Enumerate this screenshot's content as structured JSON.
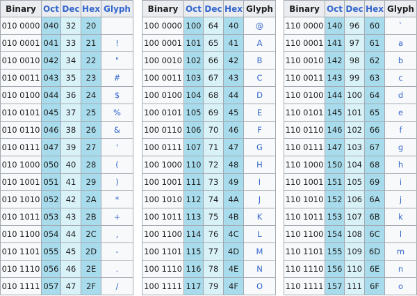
{
  "headers": {
    "binary": "Binary",
    "oct": "Oct",
    "dec": "Dec",
    "hex": "Hex",
    "glyph": "Glyph"
  },
  "tables": [
    {
      "rows": [
        [
          "010 0000",
          "040",
          "32",
          "20",
          ""
        ],
        [
          "010 0001",
          "041",
          "33",
          "21",
          "!"
        ],
        [
          "010 0010",
          "042",
          "34",
          "22",
          "\""
        ],
        [
          "010 0011",
          "043",
          "35",
          "23",
          "#"
        ],
        [
          "010 0100",
          "044",
          "36",
          "24",
          "$"
        ],
        [
          "010 0101",
          "045",
          "37",
          "25",
          "%"
        ],
        [
          "010 0110",
          "046",
          "38",
          "26",
          "&"
        ],
        [
          "010 0111",
          "047",
          "39",
          "27",
          "'"
        ],
        [
          "010 1000",
          "050",
          "40",
          "28",
          "("
        ],
        [
          "010 1001",
          "051",
          "41",
          "29",
          ")"
        ],
        [
          "010 1010",
          "052",
          "42",
          "2A",
          "*"
        ],
        [
          "010 1011",
          "053",
          "43",
          "2B",
          "+"
        ],
        [
          "010 1100",
          "054",
          "44",
          "2C",
          ","
        ],
        [
          "010 1101",
          "055",
          "45",
          "2D",
          "-"
        ],
        [
          "010 1110",
          "056",
          "46",
          "2E",
          "."
        ],
        [
          "010 1111",
          "057",
          "47",
          "2F",
          "/"
        ]
      ]
    },
    {
      "rows": [
        [
          "100 0000",
          "100",
          "64",
          "40",
          "@"
        ],
        [
          "100 0001",
          "101",
          "65",
          "41",
          "A"
        ],
        [
          "100 0010",
          "102",
          "66",
          "42",
          "B"
        ],
        [
          "100 0011",
          "103",
          "67",
          "43",
          "C"
        ],
        [
          "100 0100",
          "104",
          "68",
          "44",
          "D"
        ],
        [
          "100 0101",
          "105",
          "69",
          "45",
          "E"
        ],
        [
          "100 0110",
          "106",
          "70",
          "46",
          "F"
        ],
        [
          "100 0111",
          "107",
          "71",
          "47",
          "G"
        ],
        [
          "100 1000",
          "110",
          "72",
          "48",
          "H"
        ],
        [
          "100 1001",
          "111",
          "73",
          "49",
          "I"
        ],
        [
          "100 1010",
          "112",
          "74",
          "4A",
          "J"
        ],
        [
          "100 1011",
          "113",
          "75",
          "4B",
          "K"
        ],
        [
          "100 1100",
          "114",
          "76",
          "4C",
          "L"
        ],
        [
          "100 1101",
          "115",
          "77",
          "4D",
          "M"
        ],
        [
          "100 1110",
          "116",
          "78",
          "4E",
          "N"
        ],
        [
          "100 1111",
          "117",
          "79",
          "4F",
          "O"
        ]
      ]
    },
    {
      "rows": [
        [
          "110 0000",
          "140",
          "96",
          "60",
          "`"
        ],
        [
          "110 0001",
          "141",
          "97",
          "61",
          "a"
        ],
        [
          "110 0010",
          "142",
          "98",
          "62",
          "b"
        ],
        [
          "110 0011",
          "143",
          "99",
          "63",
          "c"
        ],
        [
          "110 0100",
          "144",
          "100",
          "64",
          "d"
        ],
        [
          "110 0101",
          "145",
          "101",
          "65",
          "e"
        ],
        [
          "110 0110",
          "146",
          "102",
          "66",
          "f"
        ],
        [
          "110 0111",
          "147",
          "103",
          "67",
          "g"
        ],
        [
          "110 1000",
          "150",
          "104",
          "68",
          "h"
        ],
        [
          "110 1001",
          "151",
          "105",
          "69",
          "i"
        ],
        [
          "110 1010",
          "152",
          "106",
          "6A",
          "j"
        ],
        [
          "110 1011",
          "153",
          "107",
          "6B",
          "k"
        ],
        [
          "110 1100",
          "154",
          "108",
          "6C",
          "l"
        ],
        [
          "110 1101",
          "155",
          "109",
          "6D",
          "m"
        ],
        [
          "110 1110",
          "156",
          "110",
          "6E",
          "n"
        ],
        [
          "110 1111",
          "157",
          "111",
          "6F",
          "o"
        ]
      ]
    }
  ]
}
